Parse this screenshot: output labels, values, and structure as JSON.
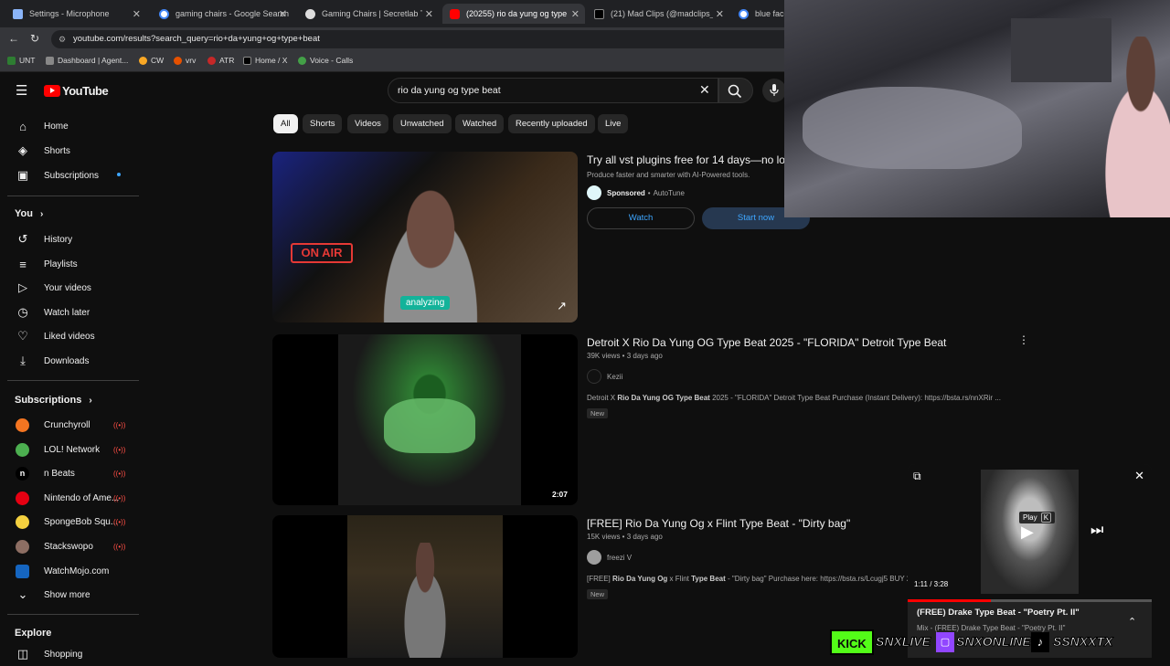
{
  "browser": {
    "tabs": [
      {
        "title": "Settings - Microphone"
      },
      {
        "title": "gaming chairs - Google Search"
      },
      {
        "title": "Gaming Chairs | Secretlab TITAN"
      },
      {
        "title": "(20255) rio da yung og type be"
      },
      {
        "title": "(21) Mad Clips (@madclips_) / X"
      },
      {
        "title": "blue face r"
      }
    ],
    "url": "youtube.com/results?search_query=rio+da+yung+og+type+beat",
    "bookmarks": [
      "UNT",
      "Dashboard | Agent...",
      "CW",
      "vrv",
      "ATR",
      "Home / X",
      "Voice - Calls"
    ]
  },
  "youtube": {
    "logo": "YouTube",
    "search": {
      "value": "rio da yung og type beat"
    },
    "sidebar": {
      "main": [
        "Home",
        "Shorts",
        "Subscriptions"
      ],
      "you_header": "You",
      "you": [
        "History",
        "Playlists",
        "Your videos",
        "Watch later",
        "Liked videos",
        "Downloads"
      ],
      "subs_header": "Subscriptions",
      "subs": [
        "Crunchyroll",
        "LOL! Network",
        "n Beats",
        "Nintendo of Ame...",
        "SpongeBob Squ...",
        "Stackswopo",
        "WatchMojo.com"
      ],
      "show_more": "Show more",
      "explore_header": "Explore",
      "explore": [
        "Shopping"
      ]
    },
    "chips": [
      "All",
      "Shorts",
      "Videos",
      "Unwatched",
      "Watched",
      "Recently uploaded",
      "Live"
    ],
    "ad": {
      "title": "Try all vst plugins free for 14 days—no lo",
      "subtitle": "Produce faster and smarter with AI-Powered tools.",
      "sponsored": "Sponsored",
      "advertiser": "AutoTune",
      "watch_label": "Watch",
      "start_label": "Start now",
      "overlay_caption": "analyzing",
      "sign": "ON AIR"
    },
    "videos": [
      {
        "title": "Detroit X Rio Da Yung OG Type Beat 2025 - \"FLORIDA\" Detroit Type Beat",
        "meta": "39K views • 3 days ago",
        "channel": "Kezii",
        "desc_prefix": "Detroit X ",
        "desc_bold": "Rio Da Yung OG Type Beat",
        "desc_suffix": " 2025 - \"FLORIDA\" Detroit Type Beat Purchase (Instant Delivery): https://bsta.rs/nnXRir ...",
        "badge": "New",
        "duration": "2:07"
      },
      {
        "title": "[FREE] Rio Da Yung Og x Flint Type Beat - \"Dirty bag\"",
        "meta": "15K views • 3 days ago",
        "channel": "freezi V",
        "desc_prefix": "[FREE] ",
        "desc_bold": "Rio Da Yung Og",
        "desc_mid": " x Flint ",
        "desc_bold2": "Type Beat",
        "desc_suffix": " - \"Dirty bag\" Purchase here: https://bsta.rs/Lcugj5 BUY 2 GI",
        "badge": "New"
      }
    ],
    "miniplayer": {
      "tooltip_label": "Play",
      "tooltip_key": "K",
      "time": "1:11 / 3:28",
      "progress": 0.34,
      "title": "(FREE) Drake Type Beat - \"Poetry Pt. II\"",
      "subtitle": "Mix - (FREE) Drake Type Beat - \"Poetry Pt. II\""
    }
  },
  "stream_overlay": {
    "kick": "KICK",
    "kick_handle": "SNXLIVE",
    "twitch_handle": "SNXONLINE",
    "tiktok_handle": "SSNXXTX"
  }
}
